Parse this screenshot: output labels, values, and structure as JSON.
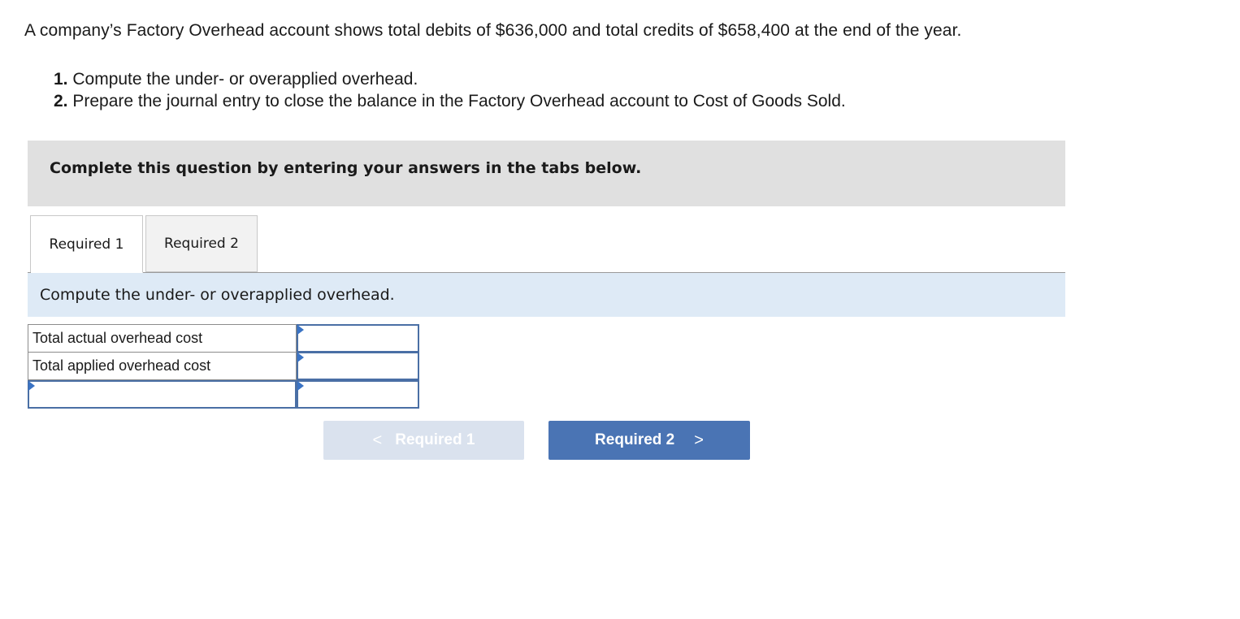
{
  "problem": {
    "intro": "A company’s Factory Overhead account shows total debits of $636,000 and total credits of $658,400 at the end of the year.",
    "requirements": [
      {
        "num": "1.",
        "text": "Compute the under- or overapplied overhead."
      },
      {
        "num": "2.",
        "text": "Prepare the journal entry to close the balance in the Factory Overhead account to Cost of Goods Sold."
      }
    ]
  },
  "instruction": "Complete this question by entering your answers in the tabs below.",
  "tabs": [
    {
      "label": "Required 1",
      "active": true
    },
    {
      "label": "Required 2",
      "active": false
    }
  ],
  "panel": {
    "prompt": "Compute the under- or overapplied overhead.",
    "rows": [
      {
        "label": "Total actual overhead cost",
        "value": ""
      },
      {
        "label": "Total applied overhead cost",
        "value": ""
      },
      {
        "label": "",
        "value": ""
      }
    ]
  },
  "nav": {
    "prev_label": "Required 1",
    "next_label": "Required 2",
    "prev_disabled": true
  },
  "colors": {
    "accent": "#4a74b4",
    "disabled": "#dae2ee",
    "prompt_bg": "#deeaf6",
    "instruction_bg": "#e0e0e0"
  }
}
